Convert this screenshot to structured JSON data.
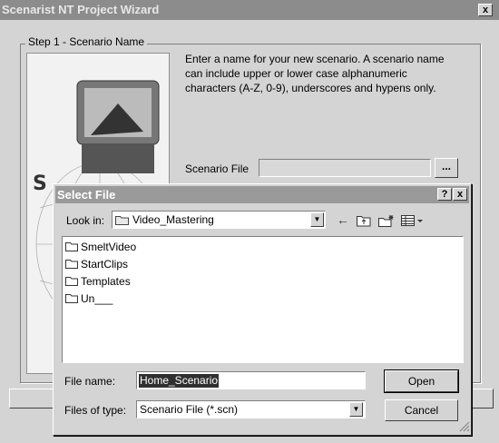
{
  "wizard": {
    "title": "Scenarist NT Project Wizard",
    "close_glyph": "x",
    "step_label": "Step 1  -  Scenario Name",
    "description": "Enter a name for your new scenario. A scenario name can include upper or lower case alphanumeric characters (A-Z, 0-9), underscores and hypens only.",
    "scenario_file_label": "Scenario File",
    "scenario_file_value": "",
    "browse_label": "..."
  },
  "dialog": {
    "title": "Select File",
    "help_glyph": "?",
    "close_glyph": "x",
    "look_in_label": "Look in:",
    "look_in_value": "Video_Mastering",
    "items": [
      {
        "label": "SmeltVideo",
        "icon": "folder-icon"
      },
      {
        "label": "StartClips",
        "icon": "folder-icon"
      },
      {
        "label": "Templates",
        "icon": "folder-icon"
      },
      {
        "label": "Un___",
        "icon": "folder-icon"
      }
    ],
    "file_name_label": "File name:",
    "file_name_value": "Home_Scenario",
    "files_of_type_label": "Files of type:",
    "files_of_type_value": "Scenario File (*.scn)",
    "open_label": "Open",
    "cancel_label": "Cancel",
    "toolbar_icons": [
      "back-arrow-icon",
      "up-folder-icon",
      "new-folder-icon",
      "view-menu-icon"
    ]
  }
}
